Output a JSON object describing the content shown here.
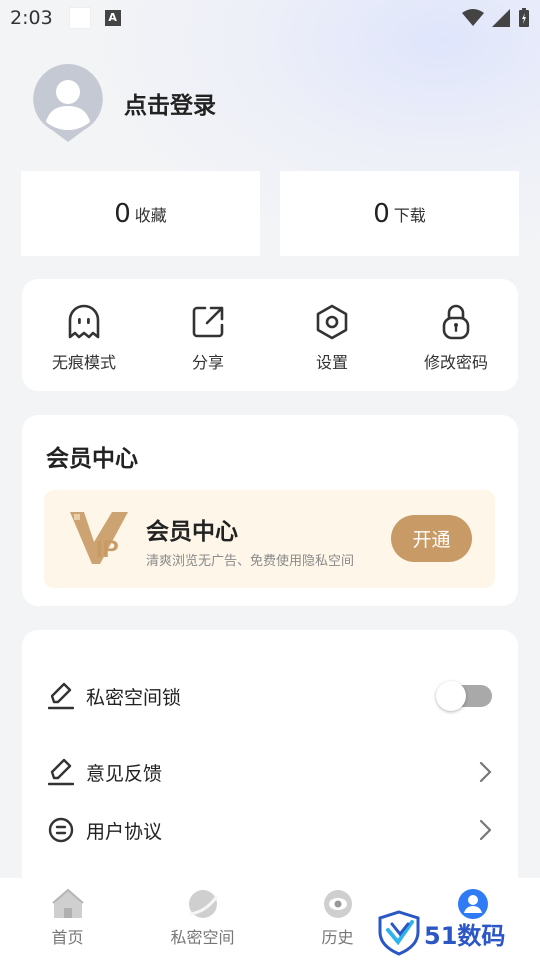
{
  "status_bar": {
    "time": "2:03",
    "a_badge": "A"
  },
  "profile": {
    "login_text": "点击登录"
  },
  "stats": [
    {
      "count": "0",
      "label": "收藏"
    },
    {
      "count": "0",
      "label": "下载"
    }
  ],
  "quick_actions": [
    {
      "label": "无痕模式",
      "icon": "ghost-icon"
    },
    {
      "label": "分享",
      "icon": "share-icon"
    },
    {
      "label": "设置",
      "icon": "settings-hexagon-icon"
    },
    {
      "label": "修改密码",
      "icon": "lock-icon"
    }
  ],
  "vip": {
    "section_title": "会员中心",
    "logo_text": "IP",
    "banner_title": "会员中心",
    "banner_desc": "清爽浏览无广告、免费使用隐私空间",
    "open_button": "开通"
  },
  "settings_list": [
    {
      "label": "私密空间锁",
      "icon": "pen-icon",
      "control": "toggle",
      "toggle_on": false
    },
    {
      "label": "意见反馈",
      "icon": "pen-icon",
      "control": "chevron"
    },
    {
      "label": "用户协议",
      "icon": "document-circle-icon",
      "control": "chevron"
    }
  ],
  "tab_bar": [
    {
      "label": "首页",
      "icon": "home-icon",
      "active": false
    },
    {
      "label": "私密空间",
      "icon": "planet-icon",
      "active": false
    },
    {
      "label": "历史",
      "icon": "eye-icon",
      "active": false
    },
    {
      "label": "",
      "icon": "user-icon",
      "active": true
    }
  ],
  "watermark": {
    "text": "51数码"
  },
  "colors": {
    "accent_blue": "#2f7bf5",
    "vip_gold": "#c89a65",
    "vip_banner_bg": "#fdf6e9",
    "toggle_off": "#a9a9a9"
  }
}
